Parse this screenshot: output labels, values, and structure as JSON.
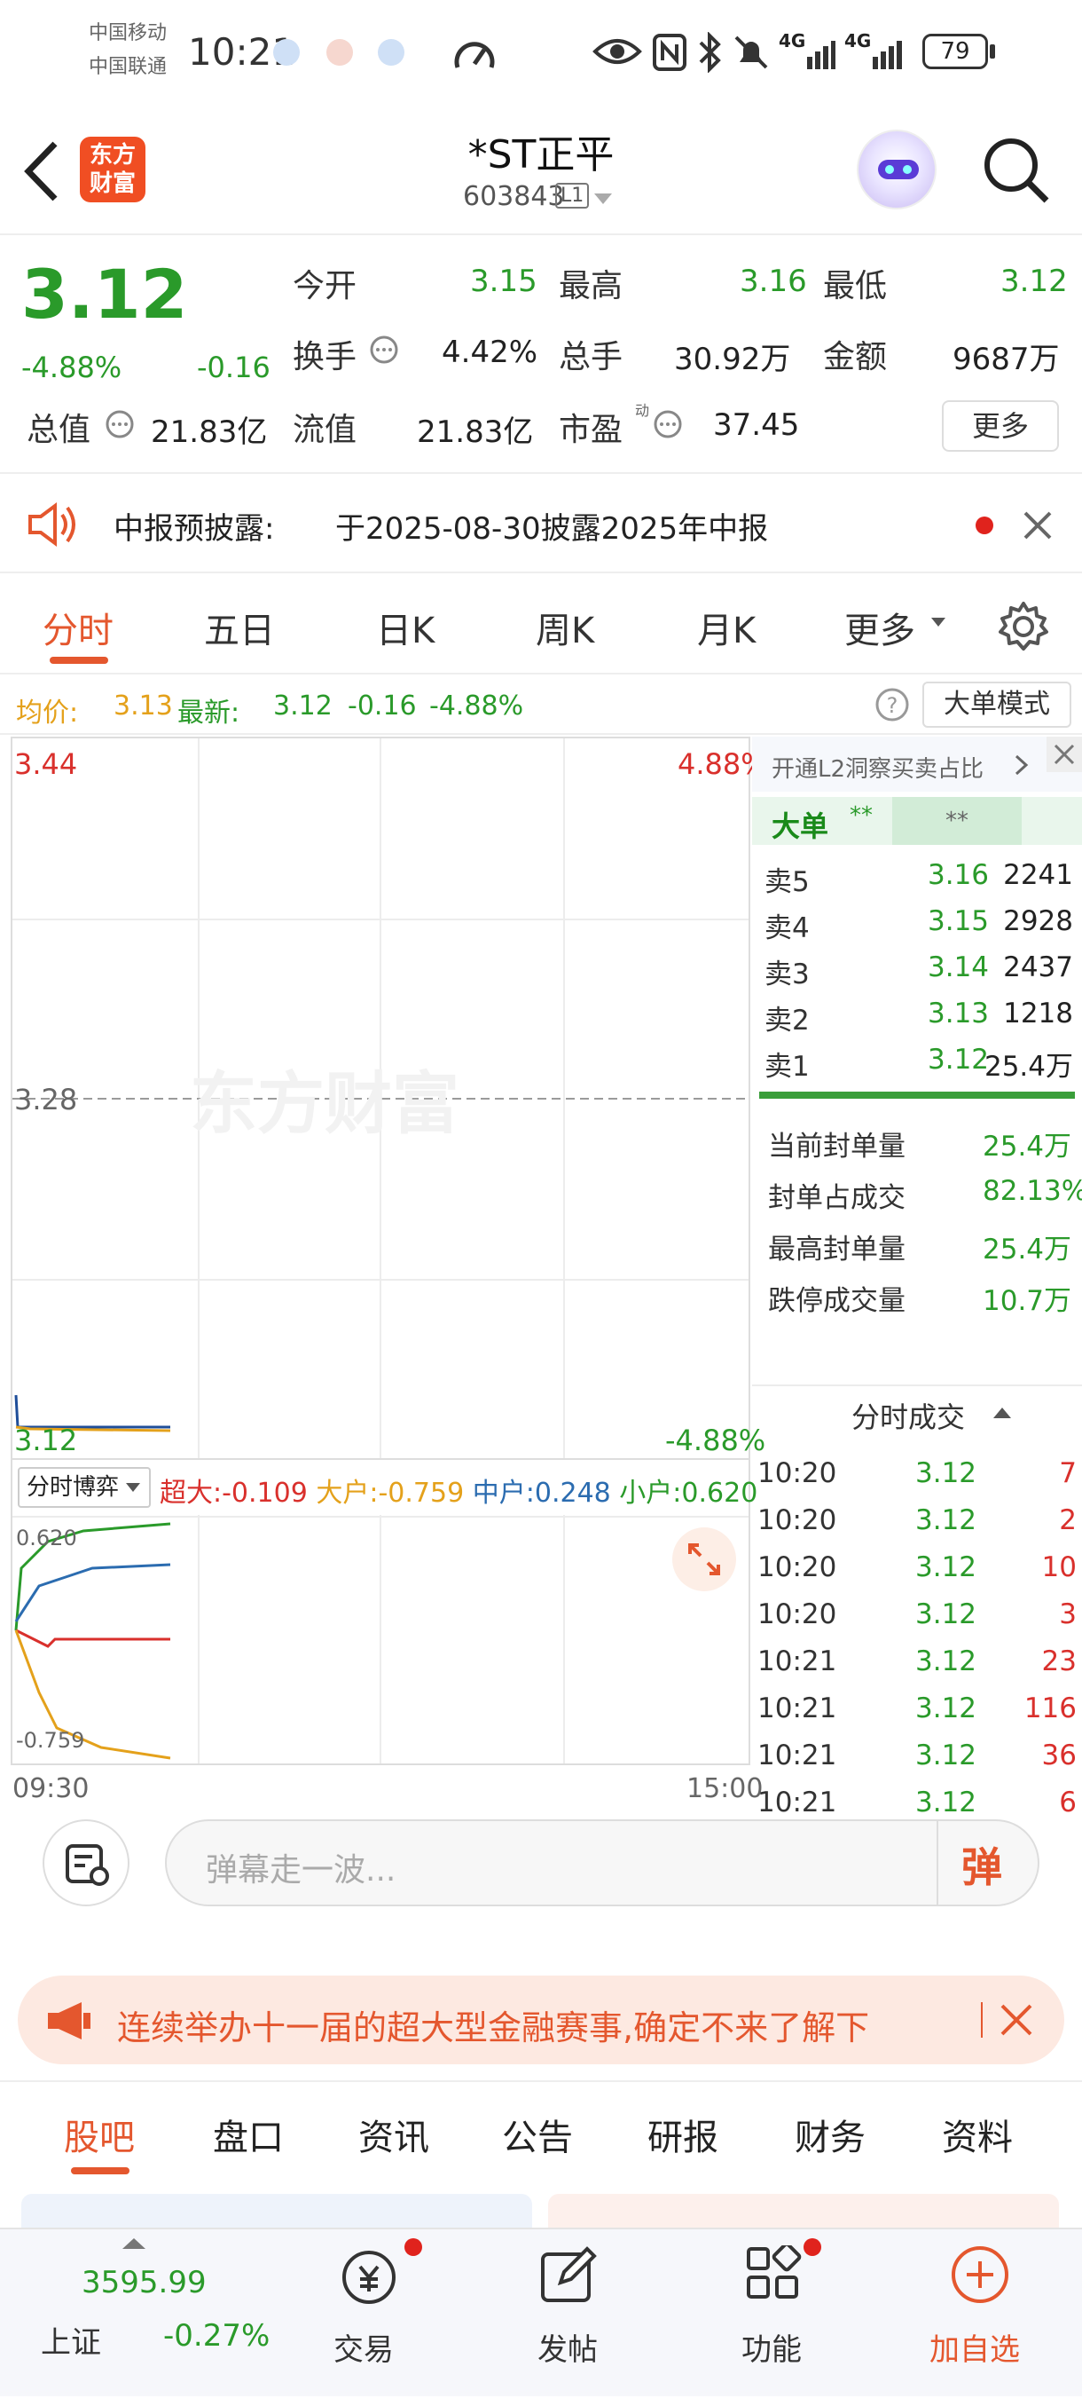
{
  "status": {
    "carrier1": "中国移动",
    "carrier2": "中国联通",
    "time": "10:21",
    "battery": "79",
    "net1": "4G",
    "net2": "4G"
  },
  "header": {
    "brand": "东方\n财富",
    "title": "*ST正平",
    "code": "603843",
    "level": "L1"
  },
  "quote": {
    "price": "3.12",
    "pct": "-4.88%",
    "chg": "-0.16",
    "items": [
      {
        "label": "今开",
        "value": "3.15"
      },
      {
        "label": "最高",
        "value": "3.16"
      },
      {
        "label": "最低",
        "value": "3.12"
      },
      {
        "label": "换手",
        "value": "4.42%"
      },
      {
        "label": "总手",
        "value": "30.92万"
      },
      {
        "label": "金额",
        "value": "9687万"
      },
      {
        "label": "总值",
        "value": "21.83亿"
      },
      {
        "label": "流值",
        "value": "21.83亿"
      },
      {
        "label": "市盈",
        "value": "37.45"
      }
    ],
    "more": "更多",
    "pe_tag": "动"
  },
  "notice": {
    "label": "中报预披露:",
    "text": "于2025-08-30披露2025年中报"
  },
  "tabs": [
    "分时",
    "五日",
    "日K",
    "周K",
    "月K",
    "更多"
  ],
  "avg_line": {
    "avg_label": "均价:",
    "avg_value": "3.13",
    "last_label": "最新:",
    "last_value": "3.12",
    "chg": "-0.16",
    "pct": "-4.88%",
    "mode_button": "大单模式"
  },
  "chart": {
    "y_top": "3.44",
    "y_mid": "3.28",
    "y_bottom": "3.12",
    "pct_top": "4.88%",
    "pct_bottom": "-4.88%",
    "watermark": "东方财富",
    "x_start": "09:30",
    "x_end": "15:00",
    "flow_select": "分时博弈",
    "flows": [
      {
        "label": "超大:",
        "value": "-0.109",
        "color": "#d9302c"
      },
      {
        "label": "大户:",
        "value": "-0.759",
        "color": "#e4a11b"
      },
      {
        "label": "中户:",
        "value": "0.248",
        "color": "#2b6cb0"
      },
      {
        "label": "小户:",
        "value": "0.620",
        "color": "#2a9a2a"
      }
    ],
    "sub_top": "0.620",
    "sub_bottom": "-0.759"
  },
  "orderbook": {
    "promo": "开通L2洞察买卖占比",
    "big_label": "大单",
    "big_stars": "**",
    "big_stars2": "**",
    "asks": [
      {
        "label": "卖5",
        "price": "3.16",
        "vol": "2241"
      },
      {
        "label": "卖4",
        "price": "3.15",
        "vol": "2928"
      },
      {
        "label": "卖3",
        "price": "3.14",
        "vol": "2437"
      },
      {
        "label": "卖2",
        "price": "3.13",
        "vol": "1218"
      },
      {
        "label": "卖1",
        "price": "3.12",
        "vol": "25.4万"
      }
    ],
    "stats": [
      {
        "label": "当前封单量",
        "value": "25.4万"
      },
      {
        "label": "封单占成交",
        "value": "82.13%"
      },
      {
        "label": "最高封单量",
        "value": "25.4万"
      },
      {
        "label": "跌停成交量",
        "value": "10.7万"
      }
    ],
    "trades_title": "分时成交",
    "trades": [
      {
        "time": "10:20",
        "price": "3.12",
        "vol": "7"
      },
      {
        "time": "10:20",
        "price": "3.12",
        "vol": "2"
      },
      {
        "time": "10:20",
        "price": "3.12",
        "vol": "10"
      },
      {
        "time": "10:20",
        "price": "3.12",
        "vol": "3"
      },
      {
        "time": "10:21",
        "price": "3.12",
        "vol": "23"
      },
      {
        "time": "10:21",
        "price": "3.12",
        "vol": "116"
      },
      {
        "time": "10:21",
        "price": "3.12",
        "vol": "36"
      },
      {
        "time": "10:21",
        "price": "3.12",
        "vol": "6"
      }
    ]
  },
  "danmu": {
    "placeholder": "弹幕走一波...",
    "button": "弹"
  },
  "banner": {
    "text": "连续举办十一届的超大型金融赛事,确定不来了解下"
  },
  "bottom_tabs": [
    "股吧",
    "盘口",
    "资讯",
    "公告",
    "研报",
    "财务",
    "资料"
  ],
  "bottom_nav": {
    "index_value": "3595.99",
    "index_name": "上证",
    "index_pct": "-0.27%",
    "items": [
      "交易",
      "发帖",
      "功能",
      "加自选"
    ]
  }
}
